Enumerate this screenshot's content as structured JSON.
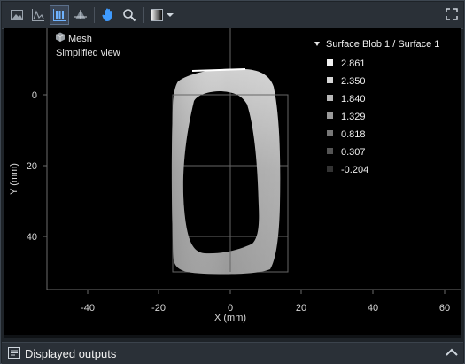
{
  "toolbar": {
    "icons": [
      "image-icon",
      "line-profile-icon",
      "volume-view-icon",
      "3d-view-icon",
      "pan-hand-icon",
      "zoom-icon",
      "colormap-gradient-icon",
      "dropdown-icon",
      "fullscreen-icon"
    ]
  },
  "overlay": {
    "mesh_label": "Mesh",
    "view_mode": "Simplified view"
  },
  "legend": {
    "title": "Surface Blob 1 / Surface 1",
    "entries": [
      {
        "value": "2.861",
        "color": "#f2f2f2"
      },
      {
        "value": "2.350",
        "color": "#d6d6d6"
      },
      {
        "value": "1.840",
        "color": "#b8b8b8"
      },
      {
        "value": "1.329",
        "color": "#9a9a9a"
      },
      {
        "value": "0.818",
        "color": "#777777"
      },
      {
        "value": "0.307",
        "color": "#555555"
      },
      {
        "value": "-0.204",
        "color": "#333333"
      }
    ]
  },
  "plot": {
    "xlabel": "X (mm)",
    "ylabel": "Y (mm)",
    "x_ticks": [
      "-40",
      "-20",
      "0",
      "20",
      "40",
      "60"
    ],
    "y_ticks": [
      "0",
      "20",
      "40"
    ]
  },
  "bottom": {
    "label": "Displayed outputs"
  }
}
